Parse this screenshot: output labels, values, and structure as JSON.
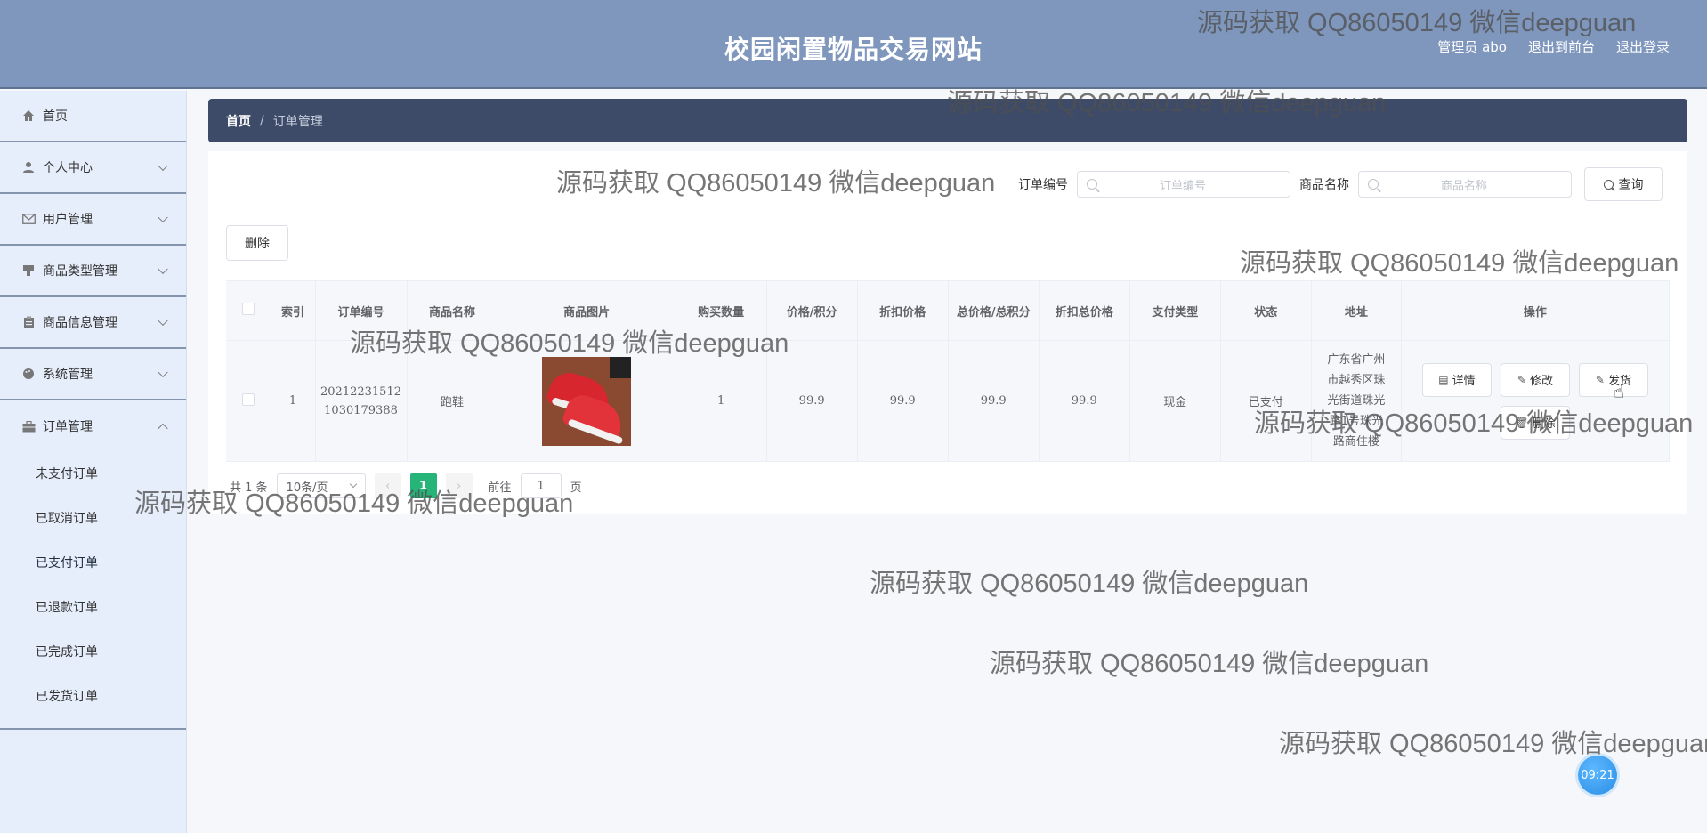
{
  "header": {
    "title": "校园闲置物品交易网站",
    "nav": [
      "管理员 abo",
      "退出到前台",
      "退出登录"
    ]
  },
  "sidebar": {
    "items": [
      {
        "label": "首页",
        "icon": "home-icon"
      },
      {
        "label": "个人中心",
        "icon": "user-icon"
      },
      {
        "label": "用户管理",
        "icon": "mail-icon"
      },
      {
        "label": "商品类型管理",
        "icon": "tag-icon"
      },
      {
        "label": "商品信息管理",
        "icon": "clipboard-icon"
      },
      {
        "label": "系统管理",
        "icon": "palette-icon"
      },
      {
        "label": "订单管理",
        "icon": "briefcase-icon"
      }
    ],
    "order_submenu": [
      "未支付订单",
      "已取消订单",
      "已支付订单",
      "已退款订单",
      "已完成订单",
      "已发货订单"
    ]
  },
  "breadcrumb": {
    "home": "首页",
    "separator": "/",
    "current": "订单管理"
  },
  "search": {
    "order_no_label": "订单编号",
    "order_no_placeholder": "订单编号",
    "product_name_label": "商品名称",
    "product_name_placeholder": "商品名称",
    "query_button": "查询"
  },
  "toolbar": {
    "delete_button": "删除"
  },
  "table": {
    "headers": [
      "索引",
      "订单编号",
      "商品名称",
      "商品图片",
      "购买数量",
      "价格/积分",
      "折扣价格",
      "总价格/总积分",
      "折扣总价格",
      "支付类型",
      "状态",
      "地址",
      "操作"
    ],
    "row": {
      "index": "1",
      "order_no_line1": "20212231512",
      "order_no_line2": "1030179388",
      "product_name": "跑鞋",
      "quantity": "1",
      "price": "99.9",
      "discount_price": "99.9",
      "total_price": "99.9",
      "discount_total": "99.9",
      "payment_type": "现金",
      "status": "已支付",
      "address_lines": [
        "广东省广州",
        "市越秀区珠",
        "光街道珠光",
        "路1号珠光",
        "路商住楼"
      ]
    },
    "actions": {
      "detail": "详情",
      "edit": "修改",
      "ship": "发货",
      "delete": "删除"
    }
  },
  "pagination": {
    "total": "共 1 条",
    "page_size": "10条/页",
    "current_page": "1",
    "goto_prefix": "前往",
    "goto_value": "1",
    "goto_suffix": "页"
  },
  "clock": "09:21",
  "watermark": "源码获取 QQ86050149 微信deepguan"
}
